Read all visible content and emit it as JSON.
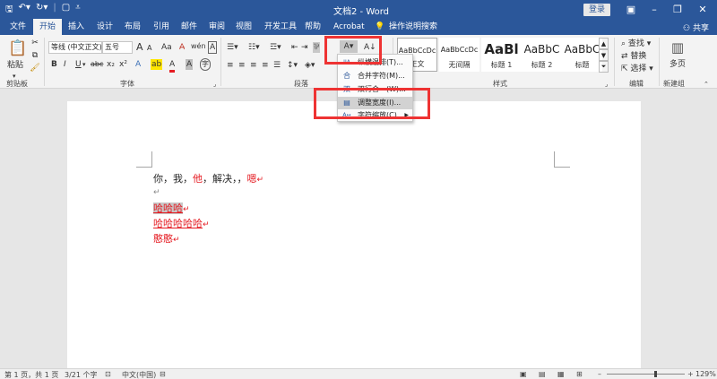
{
  "title_bar": {
    "doc_title": "文档2 - Word",
    "login": "登录"
  },
  "tabs": [
    "文件",
    "开始",
    "插入",
    "设计",
    "布局",
    "引用",
    "邮件",
    "审阅",
    "视图",
    "开发工具",
    "帮助",
    "Acrobat"
  ],
  "tell_me": "操作说明搜索",
  "share": "共享",
  "ribbon": {
    "clipboard": {
      "paste": "粘贴",
      "label": "剪贴板"
    },
    "font": {
      "name": "等线 (中文正文)",
      "size": "五号",
      "label": "字体",
      "bold": "B",
      "italic": "I",
      "underline": "U",
      "strike": "abc",
      "sub": "x₂",
      "sup": "x²",
      "grow": "A",
      "shrink": "A",
      "aa": "Aa",
      "text_effect": "A",
      "highlight": "ab",
      "font_color": "A",
      "char_border": "A",
      "char_shade": "A",
      "phonetic": "wén",
      "enclose": "字"
    },
    "paragraph": {
      "label": "段落"
    },
    "styles": {
      "label": "样式",
      "items": [
        {
          "preview": "AaBbCcDc",
          "name": "正文"
        },
        {
          "preview": "AaBbCcDc",
          "name": "无间隔"
        },
        {
          "preview": "AaBl",
          "name": "标题 1"
        },
        {
          "preview": "AaBbC",
          "name": "标题 2"
        },
        {
          "preview": "AaBbC",
          "name": "标题"
        }
      ]
    },
    "editing": {
      "find": "查找",
      "replace": "替换",
      "select": "选择",
      "label": "编辑"
    },
    "newgroup": {
      "multipage": "多页",
      "label": "新建组"
    }
  },
  "dropdown": {
    "items": [
      {
        "icon": "IIA",
        "label": "纵横混排(T)..."
      },
      {
        "icon": "合",
        "label": "合并字符(M)..."
      },
      {
        "icon": "双",
        "label": "双行合一(W)..."
      },
      {
        "icon": "▤",
        "label": "调整宽度(I)..."
      },
      {
        "icon": "A↔",
        "label": "字符缩放(C)"
      }
    ]
  },
  "document": {
    "line1": {
      "a": "你，我，",
      "b": "他",
      "c": "，解决，，",
      "d": "嗯",
      "mark": "↵"
    },
    "line2": {
      "mark": "↵"
    },
    "line3": {
      "text": "哈哈哈",
      "mark": "↵"
    },
    "line4": {
      "text": "哈哈哈哈哈",
      "mark": "↵"
    },
    "line5": {
      "text": "憨憨",
      "mark": "↵"
    }
  },
  "status": {
    "page": "第 1 页，共 1 页",
    "words": "3/21 个字",
    "lang": "中文(中国)",
    "zoom": "129%"
  },
  "colors": {
    "accent": "#2b579a",
    "highlight_red": "#e33333",
    "text_red": "#e51c23"
  }
}
